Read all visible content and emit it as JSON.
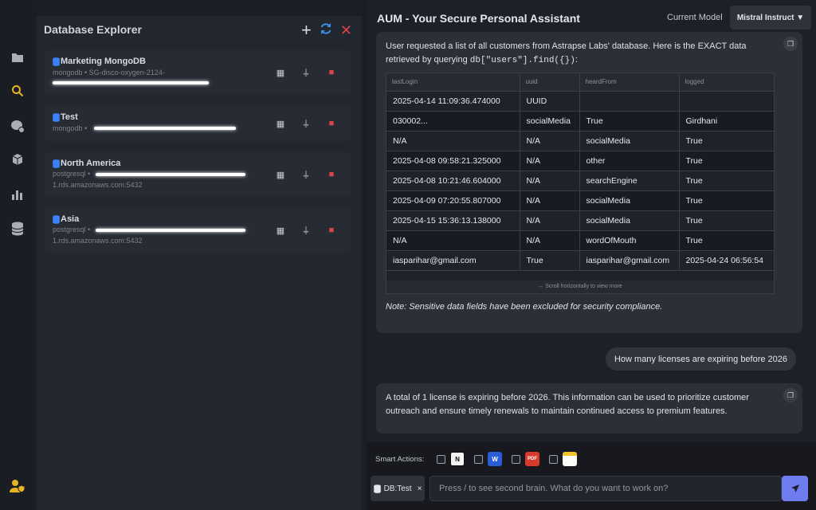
{
  "explorer": {
    "title": "Database Explorer",
    "databases": [
      {
        "name": "Marketing MongoDB",
        "line1": "mongodb • SG-disco-oxygen-2124-",
        "line2": ""
      },
      {
        "name": "Test",
        "line1": "mongodb •",
        "line2": ""
      },
      {
        "name": "North America",
        "line1": "postgresql •",
        "line2": "1.rds.amazonaws.com:5432"
      },
      {
        "name": "Asia",
        "line1": "postgresql •",
        "line2": "1.rds.amazonaws.com:5432"
      }
    ]
  },
  "chat": {
    "title": "AUM - Your Secure Personal Assistant",
    "model_label": "Current Model",
    "model_value": "Mistral Instruct ▼",
    "bot1": {
      "intro": "User requested a list of all customers from Astrapse Labs' database. Here is the EXACT data retrieved by querying",
      "code": "db[\"users\"].find({})",
      "suffix": ":",
      "columns": [
        "lastLogin",
        "uuid",
        "heardFrom",
        "logged"
      ],
      "rows": [
        [
          "2025-04-14 11:09:36.474000",
          "UUID",
          "",
          ""
        ],
        [
          "030002...",
          "socialMedia",
          "True",
          "Girdhani"
        ],
        [
          "N/A",
          "N/A",
          "socialMedia",
          "True"
        ],
        [
          "2025-04-08 09:58:21.325000",
          "N/A",
          "other",
          "True"
        ],
        [
          "2025-04-08 10:21:46.604000",
          "N/A",
          "searchEngine",
          "True"
        ],
        [
          "2025-04-09 07:20:55.807000",
          "N/A",
          "socialMedia",
          "True"
        ],
        [
          "2025-04-15 15:36:13.138000",
          "N/A",
          "socialMedia",
          "True"
        ],
        [
          "N/A",
          "N/A",
          "wordOfMouth",
          "True"
        ],
        [
          "iasparihar@gmail.com",
          "True",
          "iasparihar@gmail.com",
          "2025-04-24 06:56:54"
        ]
      ],
      "scroll_hint": "↔ Scroll horizontally to view more",
      "note": "Note: Sensitive data fields have been excluded for security compliance."
    },
    "user_msg": "How many licenses are expiring before 2026",
    "bot2": "A total of 1 license is expiring before 2026. This information can be used to prioritize customer outreach and ensure timely renewals to maintain continued access to premium features."
  },
  "bottom": {
    "smart_label": "Smart Actions:",
    "chip": "DB:Test",
    "chip_close": "×",
    "placeholder": "Press / to see second brain. What do you want to work on?"
  },
  "colors": {
    "accent": "#6f7cf0",
    "danger": "#e0424a",
    "db_blue": "#3b82f6",
    "refresh": "#3b8fe6"
  }
}
